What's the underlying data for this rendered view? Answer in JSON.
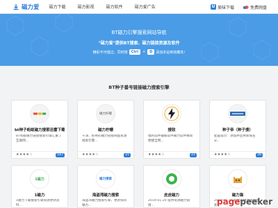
{
  "header": {
    "logo_text": "磁力爱",
    "nav": [
      "磁力下载",
      "磁力影视",
      "磁力软件",
      "磁力爱广告"
    ],
    "right_links": [
      {
        "icon": "u-icon",
        "label": "美味下载"
      },
      {
        "icon": "baidu-pan-icon",
        "label": "免费网盘"
      }
    ]
  },
  "hero": {
    "title": "BT磁力引擎搜索网站导航",
    "subtitle": "\"磁力爱\"提供BT搜索、磁力链接资源及软件",
    "hint_before": "精彩不可错过，同时按",
    "key1": "Ctrl",
    "plus": "+",
    "key2": "D",
    "hint_after": "添加本站到收藏夹!"
  },
  "section": {
    "title": "BT种子番号链接磁力搜索引擎"
  },
  "cards": [
    {
      "title": "bt种子蚂蚁磁力搜索迅雷下载",
      "desc": "BT蚂蚁磁力链接搜索引擎汇聚了互联网...",
      "stars": "★★★★☆",
      "count": "547"
    },
    {
      "title": "磁力柠檬",
      "desc": "干净、好用的磁力链接网盘资源搜索引擎...",
      "stars": "★★★★☆",
      "count": "21"
    },
    {
      "title": "搜软",
      "desc": "福利软件破解软件磁力软件精简便捷全网...",
      "stars": "★★★★☆",
      "count": "21"
    },
    {
      "title": "种子帝（种子搜）",
      "desc": "配置提示：添加并启用新域名 w...",
      "stars": "★★★★☆",
      "count": "36"
    },
    {
      "title": "1磁力",
      "desc": "1磁力下载搜索引擎资源更新及时...",
      "stars": "★★★★☆",
      "count": ""
    },
    {
      "title": "海盗湾磁力搜索",
      "desc": "海盗湾磁力搜索引擎，更新快的磁力...",
      "stars": "★★★★☆",
      "count": ""
    },
    {
      "title": "皮皮磁力",
      "desc": "2019-01-20 提供资源磁力链接...",
      "stars": "★★★★☆",
      "count": ""
    },
    {
      "title": "磁力猫",
      "desc": "2019-01-14 超赞的磁力链接搜索...",
      "stars": "★★★★☆",
      "count": ""
    }
  ],
  "thumb_labels": {
    "card2": "磁力柠檬",
    "card5": "1磁力",
    "card6": "磁力搜索"
  },
  "watermark": {
    "part1": "page",
    "part2": "peeker"
  },
  "colors": {
    "accent": "#2f7fd6",
    "hero": "#4a9ce6",
    "background": "#f2f3f5"
  }
}
